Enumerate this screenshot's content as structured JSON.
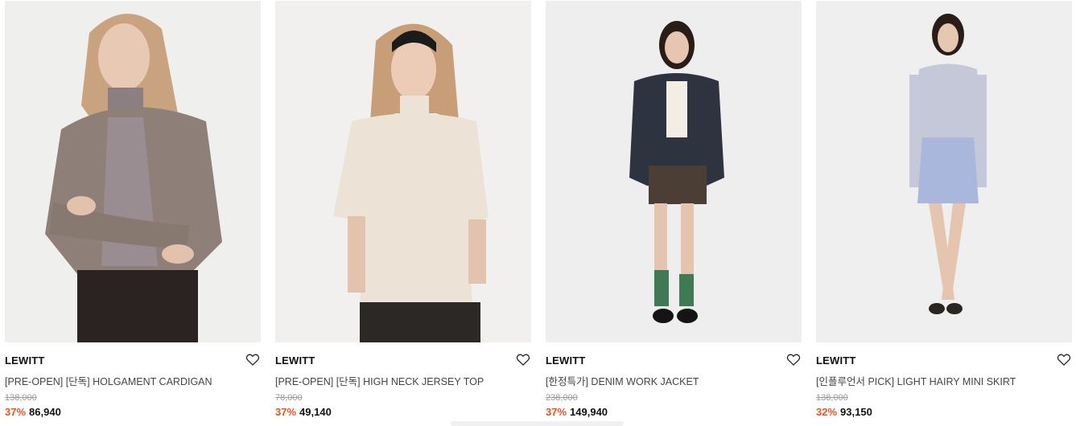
{
  "products": [
    {
      "brand": "LEWITT",
      "title": "[PRE-OPEN] [단독] HOLGAMENT CARDIGAN",
      "original_price": "138,000",
      "discount": "37%",
      "price": "86,940",
      "image": "woman in taupe knit cardigan over turtleneck, dark trousers"
    },
    {
      "brand": "LEWITT",
      "title": "[PRE-OPEN] [단독] HIGH NECK JERSEY TOP",
      "original_price": "78,000",
      "discount": "37%",
      "price": "49,140",
      "image": "woman in cream high neck jersey top with black headband"
    },
    {
      "brand": "LEWITT",
      "title": "[한정특가] DENIM WORK JACKET",
      "original_price": "238,000",
      "discount": "37%",
      "price": "149,940",
      "image": "woman in dark denim work jacket, shorts and green socks"
    },
    {
      "brand": "LEWITT",
      "title": "[인플루언서 PICK] LIGHT HAIRY MINI SKIRT",
      "original_price": "138,000",
      "discount": "32%",
      "price": "93,150",
      "image": "woman in light blue shirt and hairy mini skirt"
    }
  ],
  "colors": {
    "discount": "#e8531f",
    "brand": "#111111",
    "title": "#444444",
    "original_price": "#9a9a9a"
  },
  "icons": {
    "wishlist": "heart-outline-icon"
  }
}
